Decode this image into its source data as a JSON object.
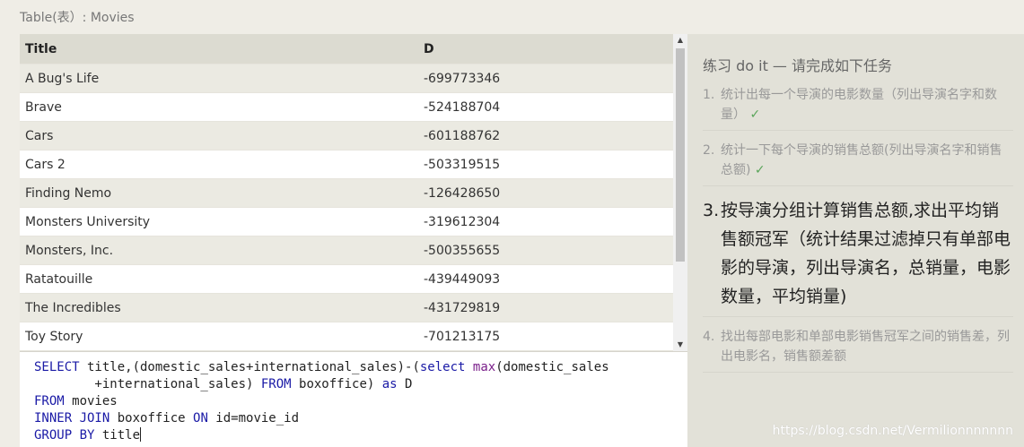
{
  "caption": "Table(表）: Movies",
  "table": {
    "headers": [
      "Title",
      "D"
    ],
    "rows": [
      [
        "A Bug's Life",
        "-699773346"
      ],
      [
        "Brave",
        "-524188704"
      ],
      [
        "Cars",
        "-601188762"
      ],
      [
        "Cars 2",
        "-503319515"
      ],
      [
        "Finding Nemo",
        "-126428650"
      ],
      [
        "Monsters University",
        "-319612304"
      ],
      [
        "Monsters, Inc.",
        "-500355655"
      ],
      [
        "Ratatouille",
        "-439449093"
      ],
      [
        "The Incredibles",
        "-431729819"
      ],
      [
        "Toy Story",
        "-701213175"
      ]
    ]
  },
  "scrollbar": {
    "up": "▲",
    "down": "▼"
  },
  "editor": {
    "l1_kw1": "SELECT",
    "l1_t1": " title,(domestic_sales+international_sales)-(",
    "l1_kw2": "select",
    "l1_t2": " ",
    "l1_fn": "max",
    "l1_t3": "(domestic_sales",
    "l2_t1": "        +international_sales) ",
    "l2_kw1": "FROM",
    "l2_t2": " boxoffice) ",
    "l2_kw2": "as",
    "l2_t3": " D",
    "l3_kw1": "FROM",
    "l3_t1": " movies",
    "l4_kw1": "INNER JOIN",
    "l4_t1": " boxoffice ",
    "l4_kw2": "ON",
    "l4_t2": " id=movie_id",
    "l5_kw1": "GROUP BY",
    "l5_t1": " title"
  },
  "tasks": {
    "title": "练习 do it — 请完成如下任务",
    "items": [
      {
        "num": "1.",
        "text": "统计出每一个导演的电影数量（列出导演名字和数量）",
        "check": "✓"
      },
      {
        "num": "2.",
        "text": "统计一下每个导演的销售总额(列出导演名字和销售总额)",
        "check": "✓"
      },
      {
        "num": "3.",
        "text": "按导演分组计算销售总额,求出平均销售额冠军（统计结果过滤掉只有单部电影的导演，列出导演名，总销量，电影数量，平均销量)",
        "check": ""
      },
      {
        "num": "4.",
        "text": "找出每部电影和单部电影销售冠军之间的销售差，列出电影名，销售额差额",
        "check": ""
      }
    ]
  },
  "watermark": "https://blog.csdn.net/Vermilionnnnnnn",
  "colors": {
    "keyword": "#1a1aa6",
    "function": "#7a1f8a",
    "check": "#5aa55a"
  }
}
